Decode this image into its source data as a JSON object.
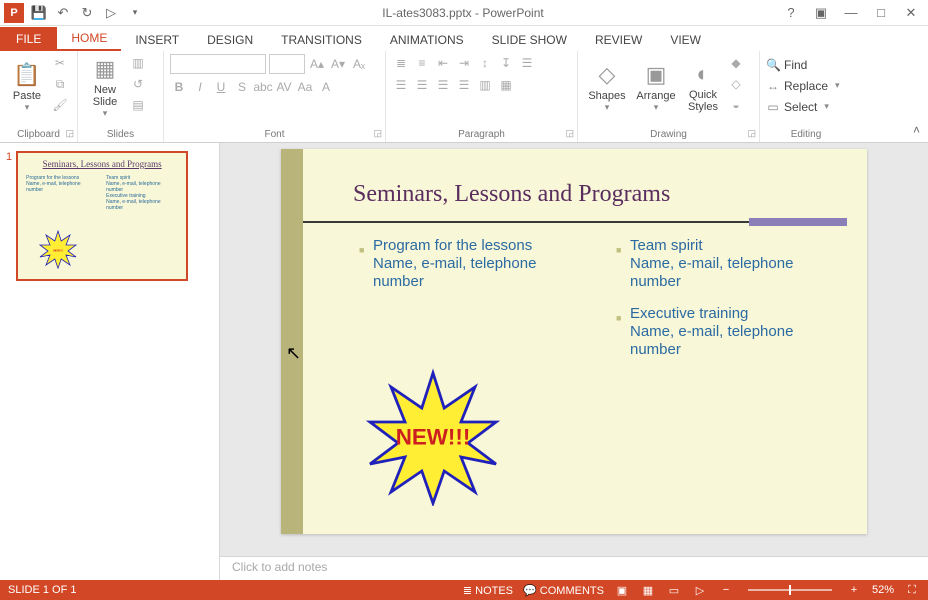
{
  "app": {
    "title": "IL-ates3083.pptx - PowerPoint",
    "icon_letter": "P"
  },
  "tabs": [
    "FILE",
    "HOME",
    "INSERT",
    "DESIGN",
    "TRANSITIONS",
    "ANIMATIONS",
    "SLIDE SHOW",
    "REVIEW",
    "VIEW"
  ],
  "ribbon": {
    "clipboard": {
      "label": "Clipboard",
      "paste": "Paste"
    },
    "slides": {
      "label": "Slides",
      "new_slide": "New\nSlide"
    },
    "font": {
      "label": "Font",
      "font_name": "",
      "font_size": ""
    },
    "paragraph": {
      "label": "Paragraph"
    },
    "drawing": {
      "label": "Drawing",
      "shapes": "Shapes",
      "arrange": "Arrange",
      "quick_styles": "Quick\nStyles"
    },
    "editing": {
      "label": "Editing",
      "find": "Find",
      "replace": "Replace",
      "select": "Select"
    }
  },
  "thumbs": {
    "items": [
      {
        "num": "1"
      }
    ]
  },
  "slide": {
    "title": "Seminars, Lessons and Programs",
    "left": [
      {
        "heading": "Program for the lessons",
        "sub": "Name, e-mail, telephone number"
      }
    ],
    "right": [
      {
        "heading": "Team spirit",
        "sub": "Name, e-mail, telephone number"
      },
      {
        "heading": "Executive training",
        "sub": "Name, e-mail, telephone number"
      }
    ],
    "star_text": "NEW!!!"
  },
  "notes": {
    "placeholder": "Click to add notes"
  },
  "status": {
    "slide_info": "SLIDE 1 OF 1",
    "notes": "NOTES",
    "comments": "COMMENTS",
    "zoom": "52%"
  }
}
